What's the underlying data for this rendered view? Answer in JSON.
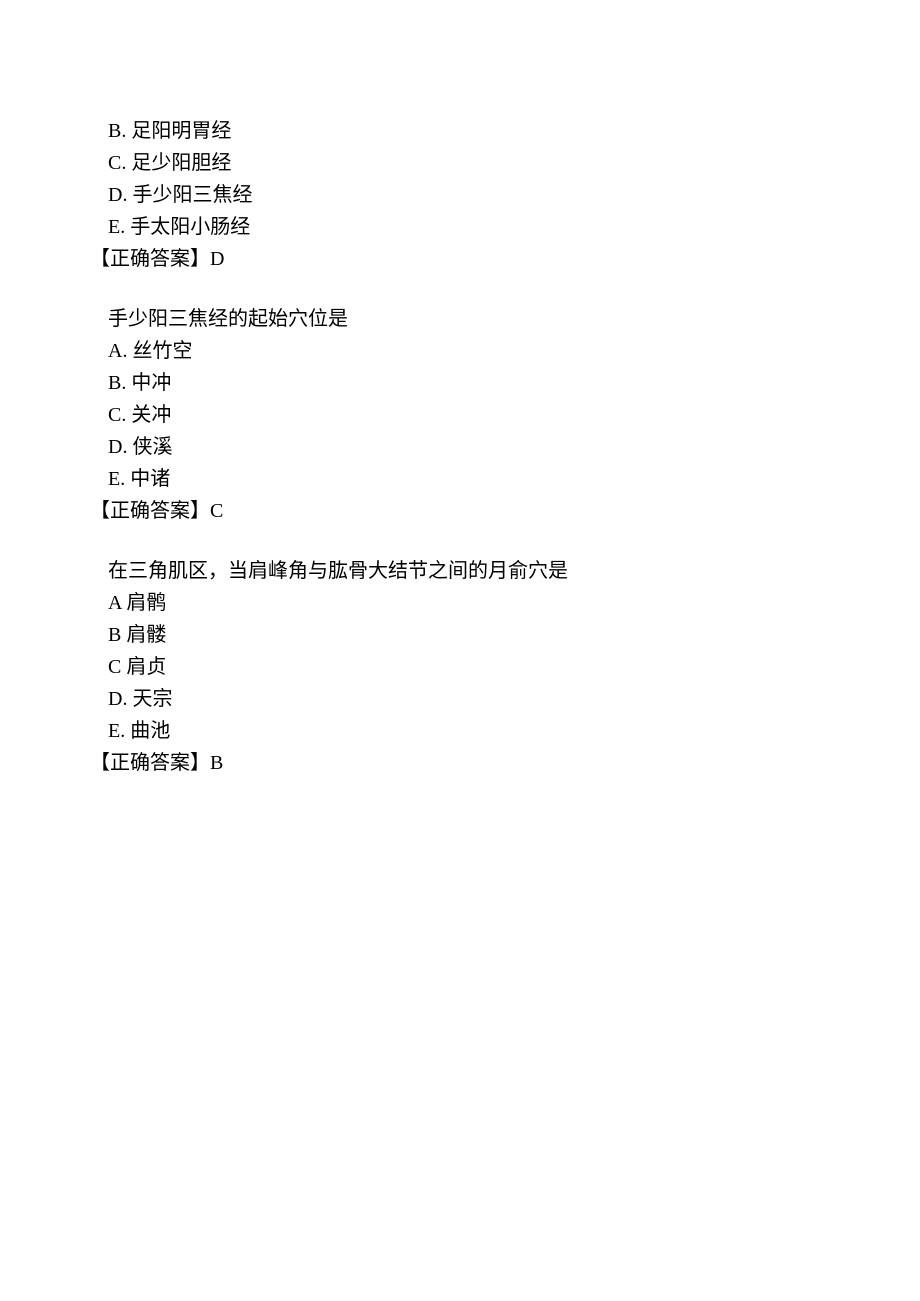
{
  "q1": {
    "optionB": "B. 足阳明胃经",
    "optionC": "C. 足少阳胆经",
    "optionD": "D. 手少阳三焦经",
    "optionE": "E. 手太阳小肠经",
    "answer": "【正确答案】D"
  },
  "q2": {
    "question": "手少阳三焦经的起始穴位是",
    "optionA": "A. 丝竹空",
    "optionB": "B. 中冲",
    "optionC": "C. 关冲",
    "optionD": "D. 侠溪",
    "optionE": "E. 中诸",
    "answer": "【正确答案】C"
  },
  "q3": {
    "question": "在三角肌区，当肩峰角与肱骨大结节之间的月俞穴是",
    "optionA": "A 肩鹘",
    "optionB": "B 肩髅",
    "optionC": "C 肩贞",
    "optionD": "D. 天宗",
    "optionE": "E. 曲池",
    "answer": "【正确答案】B"
  }
}
